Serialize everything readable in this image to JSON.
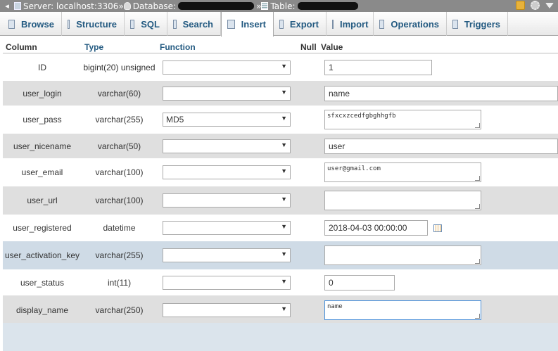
{
  "breadcrumb": {
    "server_label": "Server: localhost:3306",
    "separator": "»",
    "database_label": "Database:",
    "table_label": "Table:"
  },
  "tabs": [
    {
      "label": "Browse",
      "icon": "browse-icon"
    },
    {
      "label": "Structure",
      "icon": "structure-icon"
    },
    {
      "label": "SQL",
      "icon": "sql-icon"
    },
    {
      "label": "Search",
      "icon": "search-icon"
    },
    {
      "label": "Insert",
      "icon": "insert-icon",
      "active": true
    },
    {
      "label": "Export",
      "icon": "export-icon"
    },
    {
      "label": "Import",
      "icon": "import-icon"
    },
    {
      "label": "Operations",
      "icon": "operations-icon"
    },
    {
      "label": "Triggers",
      "icon": "triggers-icon"
    }
  ],
  "columns": {
    "column": "Column",
    "type": "Type",
    "function": "Function",
    "null": "Null",
    "value": "Value"
  },
  "rows": [
    {
      "name": "ID",
      "type": "bigint(20) unsigned",
      "function": "",
      "value": "1"
    },
    {
      "name": "user_login",
      "type": "varchar(60)",
      "function": "",
      "value": "name"
    },
    {
      "name": "user_pass",
      "type": "varchar(255)",
      "function": "MD5",
      "value": "sfxcxzcedfgbghhgfb"
    },
    {
      "name": "user_nicename",
      "type": "varchar(50)",
      "function": "",
      "value": "user"
    },
    {
      "name": "user_email",
      "type": "varchar(100)",
      "function": "",
      "value": "user@gmail.com"
    },
    {
      "name": "user_url",
      "type": "varchar(100)",
      "function": "",
      "value": ""
    },
    {
      "name": "user_registered",
      "type": "datetime",
      "function": "",
      "value": "2018-04-03 00:00:00"
    },
    {
      "name": "user_activation_key",
      "type": "varchar(255)",
      "function": "",
      "value": ""
    },
    {
      "name": "user_status",
      "type": "int(11)",
      "function": "",
      "value": "0"
    },
    {
      "name": "display_name",
      "type": "varchar(250)",
      "function": "",
      "value": "name"
    }
  ],
  "colors": {
    "tab_text": "#235a81",
    "row_alt": "#dfdfdf",
    "row_highlight": "#cfdbe6"
  }
}
